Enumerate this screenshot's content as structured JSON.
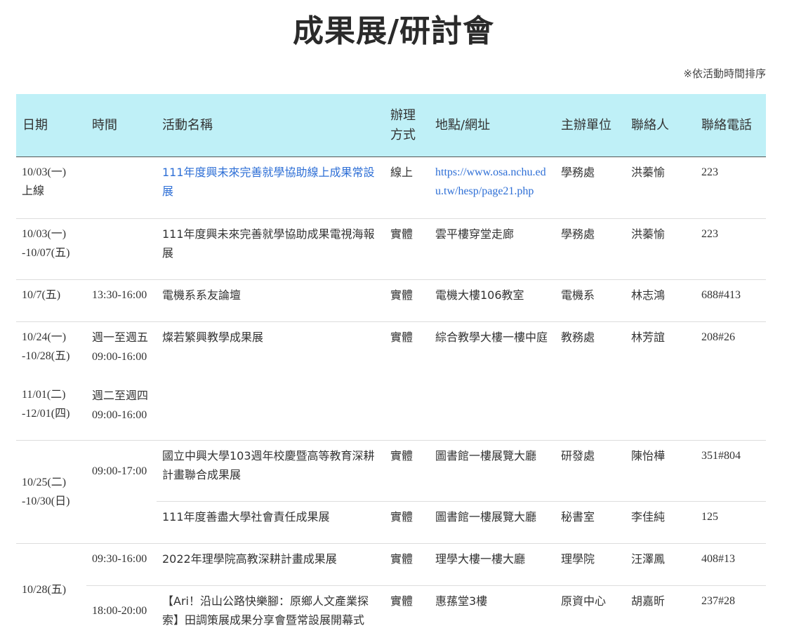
{
  "page": {
    "title": "成果展/研討會",
    "sort_note": "※依活動時間排序"
  },
  "table": {
    "headers": {
      "date": "日期",
      "time": "時間",
      "name": "活動名稱",
      "mode_line1": "辦理",
      "mode_line2": "方式",
      "location": "地點/網址",
      "host": "主辦單位",
      "contact": "聯絡人",
      "phone": "聯絡電話"
    },
    "rows": [
      {
        "date_l1": "10/03(一)",
        "date_l2": "上線",
        "time": "",
        "name": "111年度興未來完善就學協助線上成果常設展",
        "mode": "線上",
        "location": "https://www.osa.nchu.edu.tw/hesp/page21.php",
        "host": "學務處",
        "contact": "洪蓁愉",
        "phone": "223"
      },
      {
        "date_l1": "10/03(一)",
        "date_l2": "-10/07(五)",
        "time": "",
        "name": "111年度興未來完善就學協助成果電視海報展",
        "mode": "實體",
        "location": "雲平樓穿堂走廊",
        "host": "學務處",
        "contact": "洪蓁愉",
        "phone": "223"
      },
      {
        "date_l1": "10/7(五)",
        "time": "13:30-16:00",
        "name": "電機系系友論壇",
        "mode": "實體",
        "location": "電機大樓106教室",
        "host": "電機系",
        "contact": "林志鴻",
        "phone": "688#413"
      },
      {
        "date_l1": "10/24(一)",
        "date_l2": "-10/28(五)",
        "date_l3": "11/01(二)",
        "date_l4": "-12/01(四)",
        "time_l1": "週一至週五",
        "time_l2": "09:00-16:00",
        "time_l3": "週二至週四",
        "time_l4": "09:00-16:00",
        "name": "燦若繁興教學成果展",
        "mode": "實體",
        "location": "綜合教學大樓一樓中庭",
        "host": "教務處",
        "contact": "林芳誼",
        "phone": "208#26"
      },
      {
        "date_l1": "10/25(二)",
        "date_l2": "-10/30(日)",
        "time": "09:00-17:00",
        "name": "國立中興大學103週年校慶暨高等教育深耕計畫聯合成果展",
        "mode": "實體",
        "location": "圖書館一樓展覽大廳",
        "host": "研發處",
        "contact": "陳怡樺",
        "phone": "351#804"
      },
      {
        "name": "111年度善盡大學社會責任成果展",
        "mode": "實體",
        "location": "圖書館一樓展覽大廳",
        "host": "秘書室",
        "contact": "李佳純",
        "phone": "125"
      },
      {
        "date_l1": "10/28(五)",
        "time": "09:30-16:00",
        "name": "2022年理學院高教深耕計畫成果展",
        "mode": "實體",
        "location": "理學大樓一樓大廳",
        "host": "理學院",
        "contact": "汪澤鳳",
        "phone": "408#13"
      },
      {
        "time": "18:00-20:00",
        "name": "【Ari！沿山公路快樂腳：原鄉人文產業探索】田調策展成果分享會暨常設展開幕式",
        "mode": "實體",
        "location": "惠蓀堂3樓",
        "host": "原資中心",
        "contact": "胡嘉昕",
        "phone": "237#28"
      }
    ]
  }
}
